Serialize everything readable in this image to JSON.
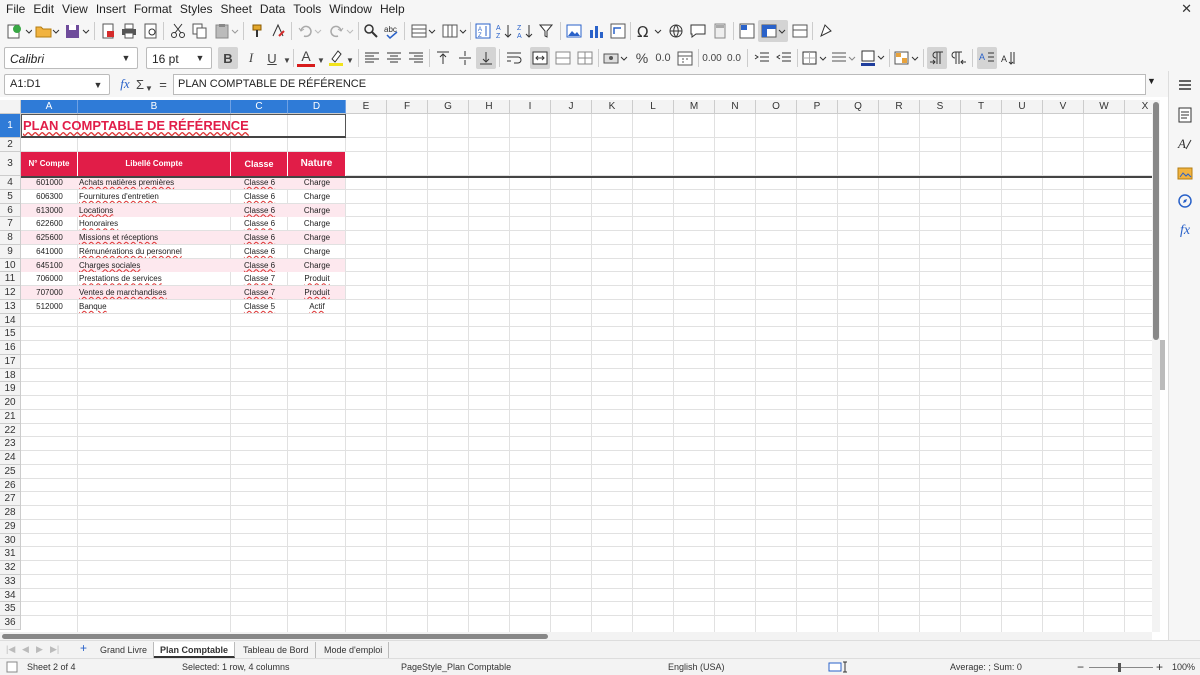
{
  "menubar": {
    "items": [
      "File",
      "Edit",
      "View",
      "Insert",
      "Format",
      "Styles",
      "Sheet",
      "Data",
      "Tools",
      "Window",
      "Help"
    ],
    "close_glyph": "✕"
  },
  "format_bar": {
    "font_name": "Calibri",
    "font_size": "16 pt",
    "bold_label": "B",
    "italic_label": "I",
    "underline_label": "U",
    "font_color_label": "A",
    "percent_label": "%",
    "decimal_label": "0.0",
    "add_decimal_label": "0.00",
    "del_decimal_label": "0.0",
    "font_color": "#d71b1b",
    "highlight_color": "#f1e31c",
    "border_color": "#1f3e9c"
  },
  "formula_bar": {
    "name_box": "A1:D1",
    "fx_label": "fx",
    "sum_label": "Σ",
    "equals_label": "=",
    "content": "PLAN COMPTABLE DE RÉFÉRENCE"
  },
  "grid": {
    "column_headers": [
      "A",
      "B",
      "C",
      "D",
      "E",
      "F",
      "G",
      "H",
      "I",
      "J",
      "K",
      "L",
      "M",
      "N",
      "O",
      "P",
      "Q",
      "R",
      "S",
      "T",
      "U",
      "V",
      "W",
      "X"
    ],
    "row_headers": [
      "1",
      "2",
      "3",
      "4",
      "5",
      "6",
      "7",
      "8",
      "9",
      "10",
      "11",
      "12",
      "13",
      "14",
      "15",
      "16",
      "17",
      "18",
      "19",
      "20",
      "21",
      "22",
      "23",
      "24",
      "25",
      "26",
      "27",
      "28",
      "29",
      "30",
      "31",
      "32",
      "33",
      "34",
      "35",
      "36"
    ],
    "title": "PLAN COMPTABLE DE RÉFÉRENCE",
    "table_headers": [
      "N° Compte",
      "Libellé Compte",
      "Classe",
      "Nature"
    ],
    "rows": [
      {
        "compte": "601000",
        "libelle": "Achats matières premières",
        "classe": "Classe 6",
        "nature": "Charge"
      },
      {
        "compte": "606300",
        "libelle": "Fournitures d'entretien",
        "classe": "Classe 6",
        "nature": "Charge"
      },
      {
        "compte": "613000",
        "libelle": "Locations",
        "classe": "Classe 6",
        "nature": "Charge"
      },
      {
        "compte": "622600",
        "libelle": "Honoraires",
        "classe": "Classe 6",
        "nature": "Charge"
      },
      {
        "compte": "625600",
        "libelle": "Missions et réceptions",
        "classe": "Classe 6",
        "nature": "Charge"
      },
      {
        "compte": "641000",
        "libelle": "Rémunérations du personnel",
        "classe": "Classe 6",
        "nature": "Charge"
      },
      {
        "compte": "645100",
        "libelle": "Charges sociales",
        "classe": "Classe 6",
        "nature": "Charge"
      },
      {
        "compte": "706000",
        "libelle": "Prestations de services",
        "classe": "Classe 7",
        "nature": "Produit"
      },
      {
        "compte": "707000",
        "libelle": "Ventes de marchandises",
        "classe": "Classe 7",
        "nature": "Produit"
      },
      {
        "compte": "512000",
        "libelle": "Banque",
        "classe": "Classe 5",
        "nature": "Actif"
      }
    ],
    "accent_color": "#e11d48",
    "stripe_color": "#fde8ee"
  },
  "sheet_tabs": {
    "add_glyph": "+",
    "tabs": [
      "Grand Livre",
      "Plan Comptable",
      "Tableau de Bord",
      "Mode d'emploi"
    ],
    "active": "Plan Comptable"
  },
  "status_bar": {
    "sheet": "Sheet 2 of 4",
    "selection": "Selected: 1 row, 4 columns",
    "page_style": "PageStyle_Plan Comptable",
    "language": "English (USA)",
    "summary": "Average: ; Sum: 0",
    "zoom_minus": "−",
    "zoom_plus": "+",
    "zoom": "100%"
  }
}
